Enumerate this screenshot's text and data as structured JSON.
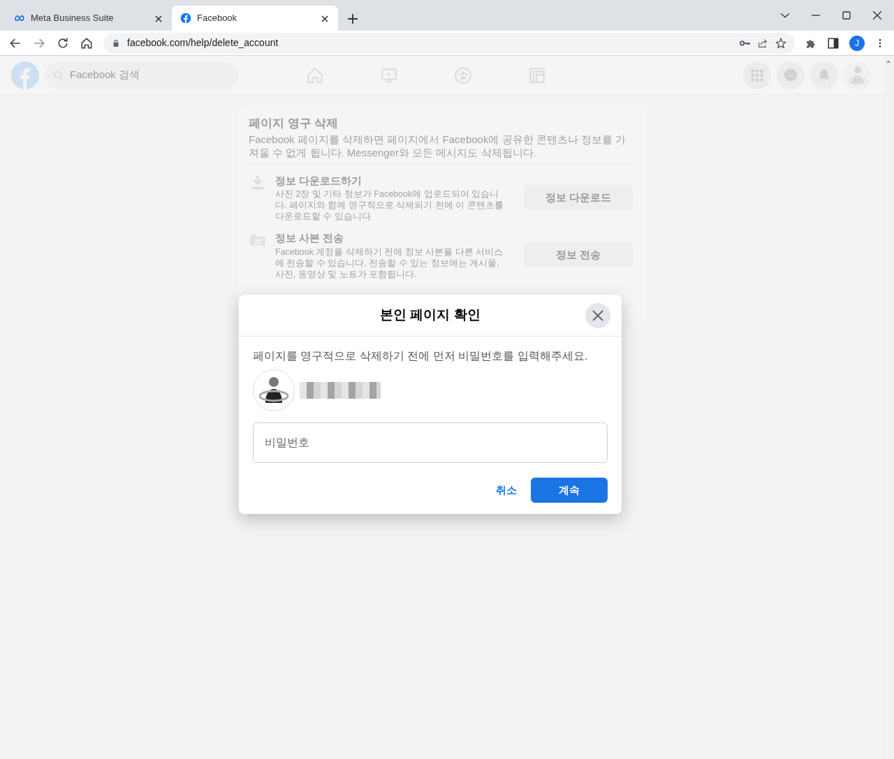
{
  "browser": {
    "tabs": [
      {
        "title": "Meta Business Suite",
        "kind": "meta",
        "selected": false
      },
      {
        "title": "Facebook",
        "kind": "facebook",
        "selected": true
      }
    ],
    "address": "facebook.com/help/delete_account",
    "profile_initial": "J"
  },
  "header": {
    "search_placeholder": "Facebook 검색"
  },
  "card": {
    "title": "페이지 영구 삭제",
    "description": "Facebook 페이지를 삭제하면 페이지에서 Facebook에 공유한 콘텐츠나 정보를 가져올 수 없게 됩니다. Messenger와 모든 메시지도 삭제됩니다.",
    "sections": [
      {
        "kind": "download",
        "title": "정보 다운로드하기",
        "text": "사진 2장 및 기타 정보가 Facebook에 업로드되어 있습니다. 페이지와 함께 영구적으로 삭제되기 전에 이 콘텐츠를 다운로드할 수 있습니다",
        "button": "정보 다운로드"
      },
      {
        "kind": "transfer",
        "title": "정보 사본 전송",
        "text": "Facebook 계정을 삭제하기 전에 정보 사본을 다른 서비스에 전송할 수 있습니다. 전송할 수 있는 정보에는 게시물, 사진, 동영상 및 노트가 포함됩니다.",
        "button": "정보 전송"
      }
    ]
  },
  "dialog": {
    "title": "본인 페이지 확인",
    "message": "페이지를 영구적으로 삭제하기 전에 먼저 비밀번호를 입력해주세요.",
    "password_placeholder": "비밀번호",
    "cancel": "취소",
    "continue": "계속"
  }
}
